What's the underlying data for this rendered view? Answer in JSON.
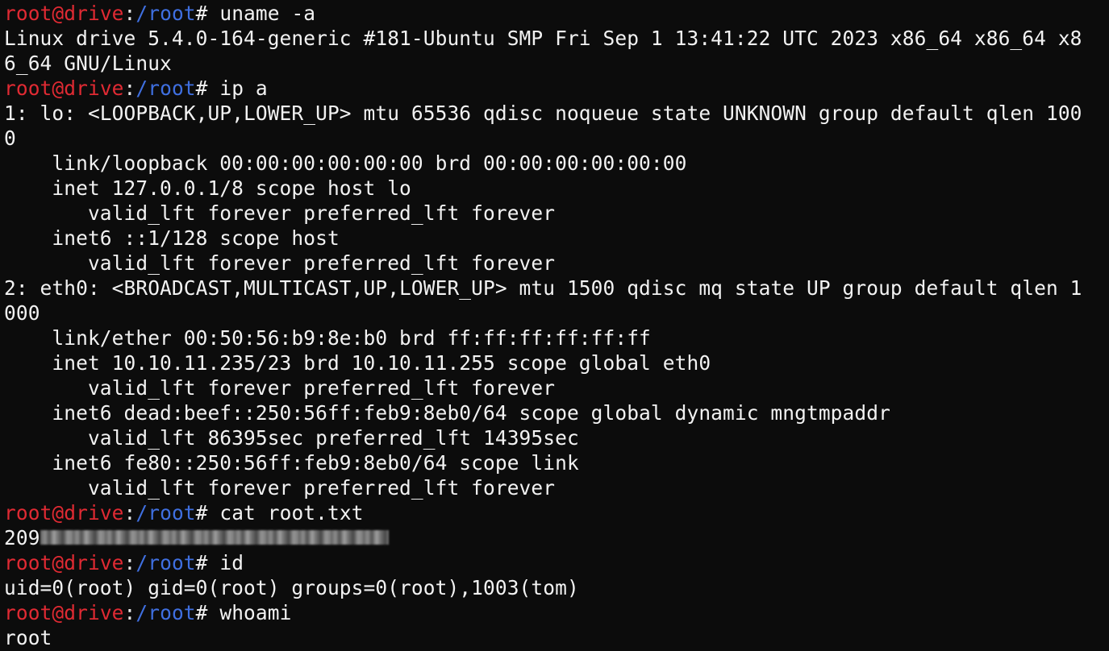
{
  "prompt": {
    "user": "root",
    "at": "@",
    "host": "drive",
    "colon": ":",
    "path": "/root",
    "symbol": "# "
  },
  "lines": {
    "cmd1": "uname -a",
    "out1a": "Linux drive 5.4.0-164-generic #181-Ubuntu SMP Fri Sep 1 13:41:22 UTC 2023 x86_64 x86_64 x8",
    "out1b": "6_64 GNU/Linux",
    "cmd2": "ip a",
    "o2_1": "1: lo: <LOOPBACK,UP,LOWER_UP> mtu 65536 qdisc noqueue state UNKNOWN group default qlen 100",
    "o2_2": "0",
    "o2_3": "    link/loopback 00:00:00:00:00:00 brd 00:00:00:00:00:00",
    "o2_4": "    inet 127.0.0.1/8 scope host lo",
    "o2_5": "       valid_lft forever preferred_lft forever",
    "o2_6": "    inet6 ::1/128 scope host",
    "o2_7": "       valid_lft forever preferred_lft forever",
    "o2_8": "2: eth0: <BROADCAST,MULTICAST,UP,LOWER_UP> mtu 1500 qdisc mq state UP group default qlen 1",
    "o2_9": "000",
    "o2_10": "    link/ether 00:50:56:b9:8e:b0 brd ff:ff:ff:ff:ff:ff",
    "o2_11": "    inet 10.10.11.235/23 brd 10.10.11.255 scope global eth0",
    "o2_12": "       valid_lft forever preferred_lft forever",
    "o2_13": "    inet6 dead:beef::250:56ff:feb9:8eb0/64 scope global dynamic mngtmpaddr",
    "o2_14": "       valid_lft 86395sec preferred_lft 14395sec",
    "o2_15": "    inet6 fe80::250:56ff:feb9:8eb0/64 scope link",
    "o2_16": "       valid_lft forever preferred_lft forever",
    "cmd3": "cat root.txt",
    "out3": "209",
    "cmd4": "id",
    "out4": "uid=0(root) gid=0(root) groups=0(root),1003(tom)",
    "cmd5": "whoami",
    "out5": "root"
  },
  "colors": {
    "background": "#0c0c0c",
    "foreground": "#f2f2f2",
    "prompt_user_host": "#e02a33",
    "prompt_path": "#3f6fe0"
  }
}
